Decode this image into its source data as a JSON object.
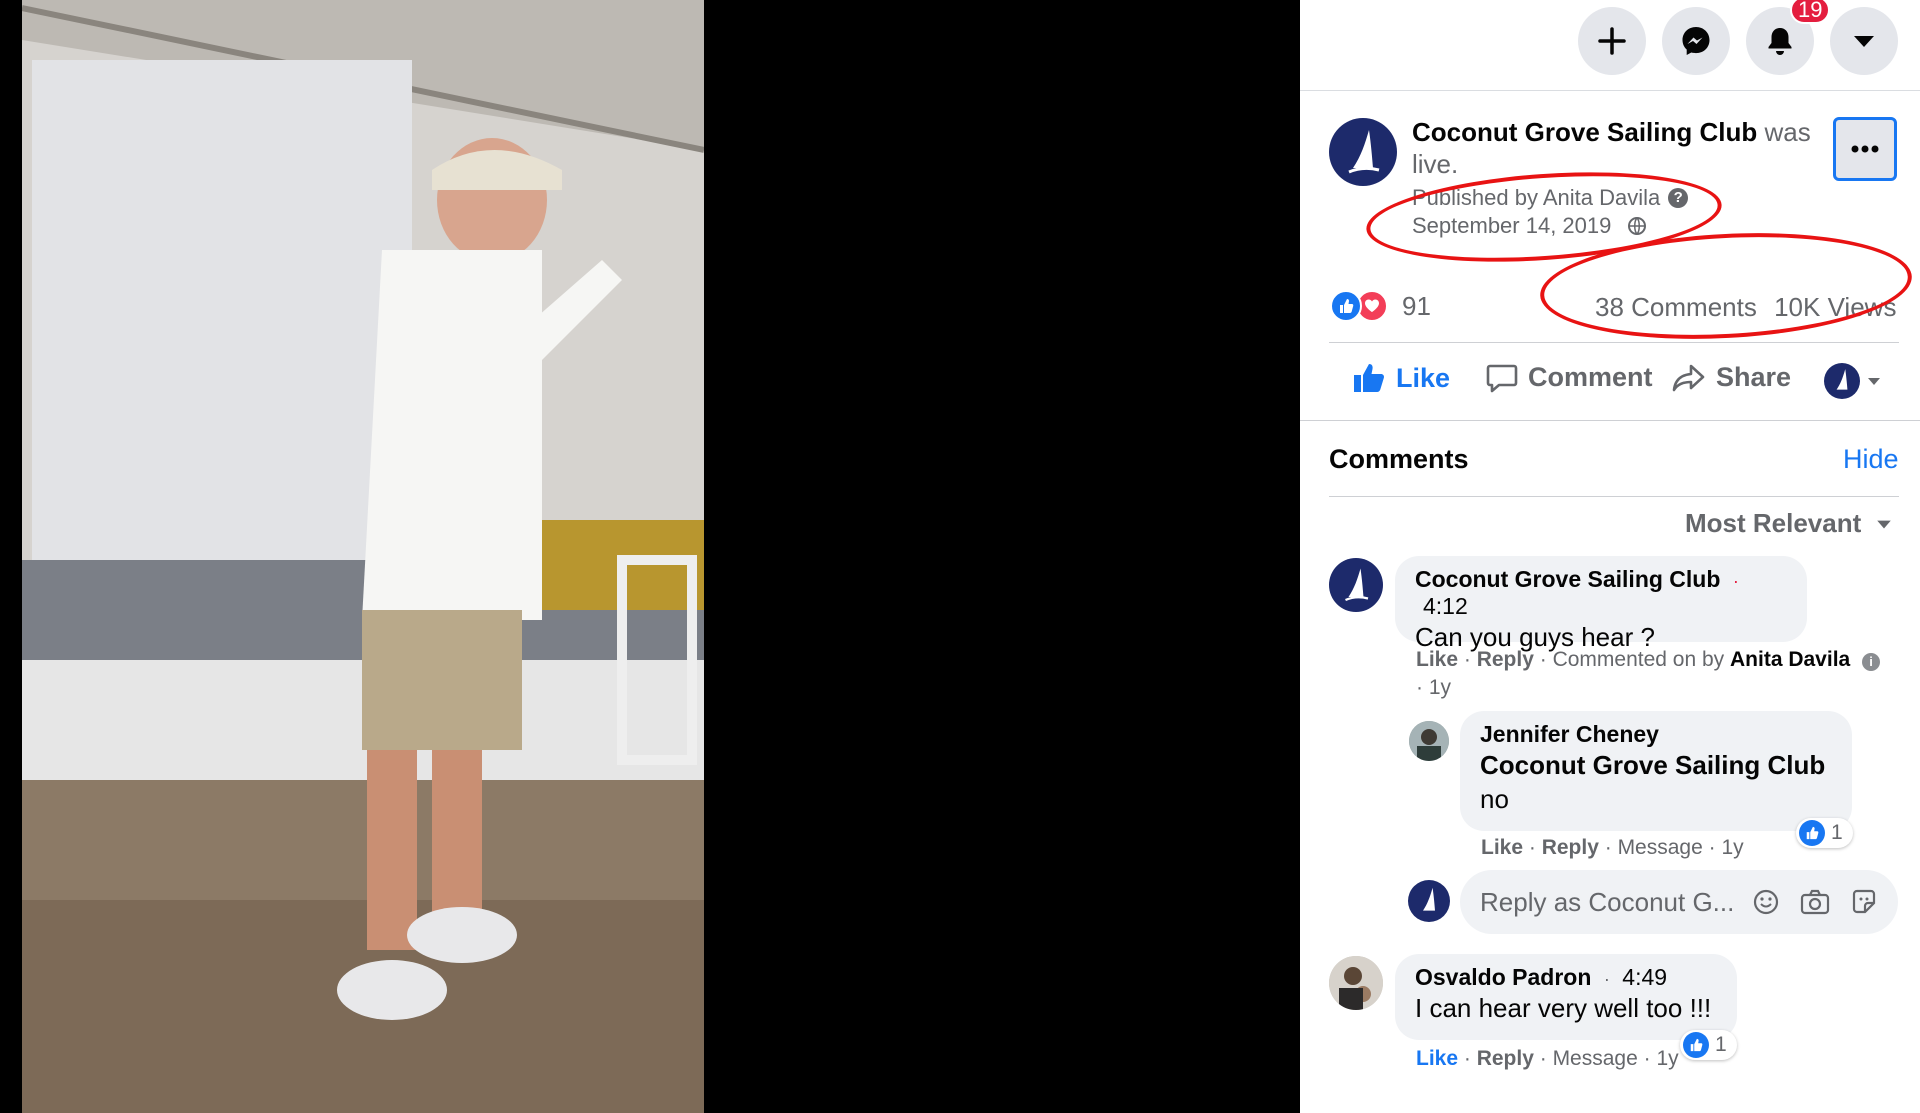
{
  "topbar": {
    "notifications_count": "19",
    "icons": [
      "plus-icon",
      "messenger-icon",
      "bell-icon",
      "caret-down-icon"
    ]
  },
  "post": {
    "page_name": "Coconut Grove Sailing Club",
    "status_suffix": "was live.",
    "published_by": "Published by Anita Davila",
    "date": "September 14, 2019",
    "reaction_count": "91",
    "comments_count": "38 Comments",
    "views_count": "10K Views"
  },
  "actions": {
    "like": "Like",
    "comment": "Comment",
    "share": "Share"
  },
  "comments_section": {
    "header": "Comments",
    "hide": "Hide",
    "sort": "Most Relevant",
    "items": [
      {
        "author": "Coconut Grove Sailing Club",
        "time": "4:12",
        "text": "Can you guys hear ?",
        "like": "Like",
        "reply": "Reply",
        "commented_on_by_prefix": "Commented on by",
        "commented_on_by": "Anita Davila",
        "age": "· 1y"
      },
      {
        "author": "Jennifer Cheney",
        "mention": "Coconut Grove Sailing Club",
        "text": "no",
        "like": "Like",
        "reply": "Reply",
        "message": "Message",
        "age": "1y",
        "like_count": "1"
      },
      {
        "author": "Osvaldo Padron",
        "time": "4:49",
        "text": "I can hear very well too !!!",
        "like": "Like",
        "reply": "Reply",
        "message": "Message",
        "age": "1y",
        "like_count": "1"
      }
    ],
    "reply_placeholder": "Reply as Coconut G..."
  },
  "colors": {
    "facebook_blue": "#1877f2",
    "badge_red": "#e41e3f",
    "annotation_red": "#e81313",
    "page_avatar": "#1d2a6b"
  }
}
